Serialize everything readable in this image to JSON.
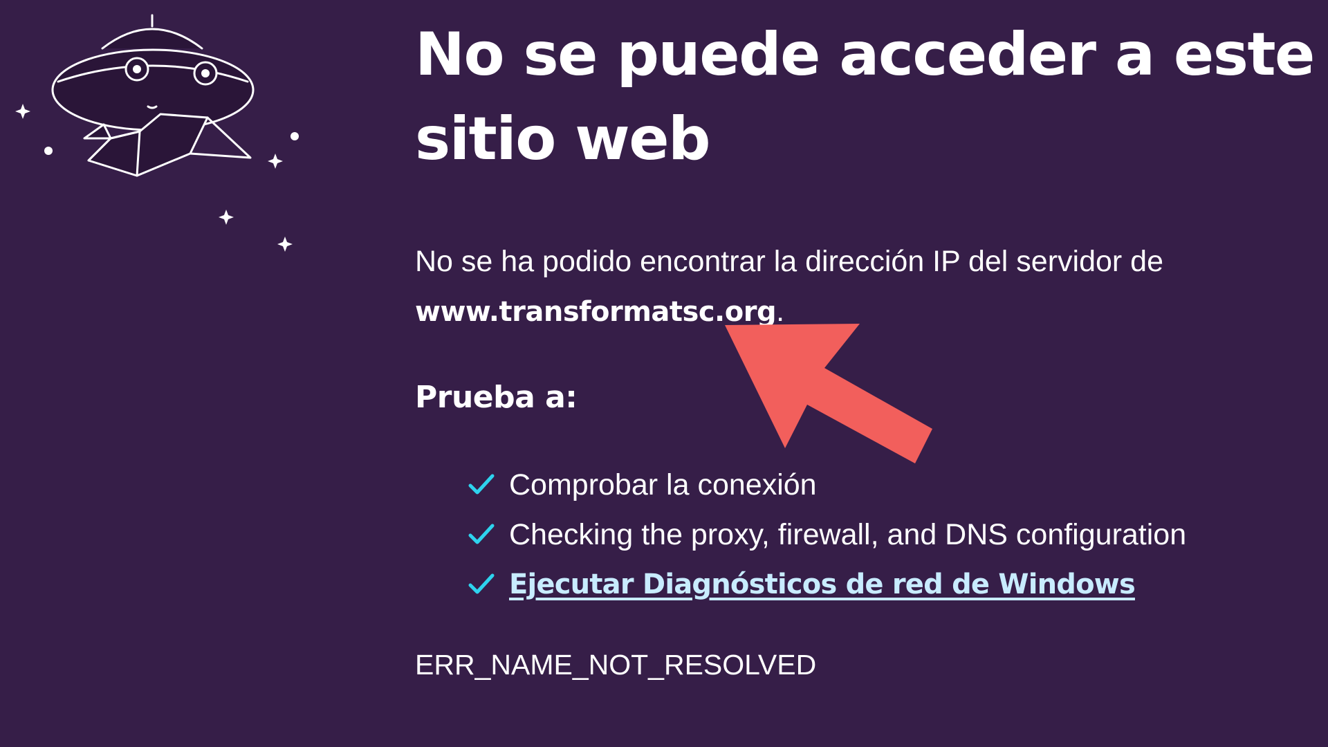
{
  "illustration": {
    "name": "ufo-illustration",
    "icon": "ufo-icon"
  },
  "error_page": {
    "title": "No se puede acceder a este sitio web",
    "description_prefix": "No se ha podido encontrar la dirección IP del servidor de",
    "host": "www.transformatsc.org",
    "description_suffix": ".",
    "try_heading": "Prueba a:",
    "suggestions": [
      {
        "label": "Comprobar la conexión",
        "icon": "checkmark-icon",
        "link": false
      },
      {
        "label": "Checking the proxy, firewall, and DNS configuration",
        "icon": "checkmark-icon",
        "link": false
      },
      {
        "label": "Ejecutar Diagnósticos de red de Windows",
        "icon": "checkmark-icon",
        "link": true
      }
    ],
    "error_code": "ERR_NAME_NOT_RESOLVED"
  },
  "annotation": {
    "icon": "arrow-pointer-icon",
    "color": "#f25f5c"
  },
  "colors": {
    "background": "#361e48",
    "text": "#ffffff",
    "check": "#2ed3ee",
    "link": "#c8ecff"
  }
}
